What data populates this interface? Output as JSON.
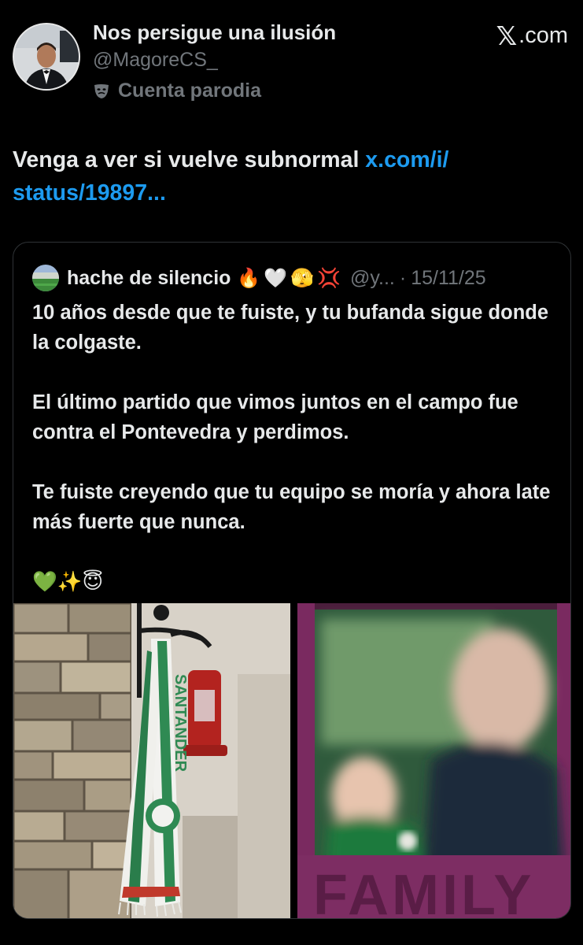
{
  "post": {
    "display_name": "Nos persigue una ilusión",
    "handle": "@MagoreCS_",
    "parody_label": "Cuenta parodia",
    "parody_icon": "theater-mask-icon",
    "brand": ".com",
    "text_plain": "Venga a ver si vuelve subnormal ",
    "text_link_1": "x.com/i/",
    "text_link_2": "status/19897..."
  },
  "quoted": {
    "display_name": "hache de silencio",
    "name_emojis": [
      "🔥",
      "🤍",
      "🫣",
      "💢"
    ],
    "handle": "@y...",
    "separator": "·",
    "date": "15/11/25",
    "paragraphs": [
      "10 años desde que te fuiste, y tu bufanda sigue donde la colgaste.",
      "El último partido que vimos juntos en el campo fue contra el Pontevedra y perdimos.",
      "Te fuiste creyendo que tu equipo se moría y ahora late más fuerte que nunca.",
      "💚✨😇"
    ],
    "media": [
      {
        "name": "scarf-photo",
        "scarf_text": "SANTANDER"
      },
      {
        "name": "family-photo",
        "overlay_text": "FAMILY"
      }
    ]
  },
  "colors": {
    "background": "#000000",
    "text": "#e7e9ea",
    "muted": "#71767b",
    "link": "#1d9bf0",
    "border": "#2f3336"
  }
}
